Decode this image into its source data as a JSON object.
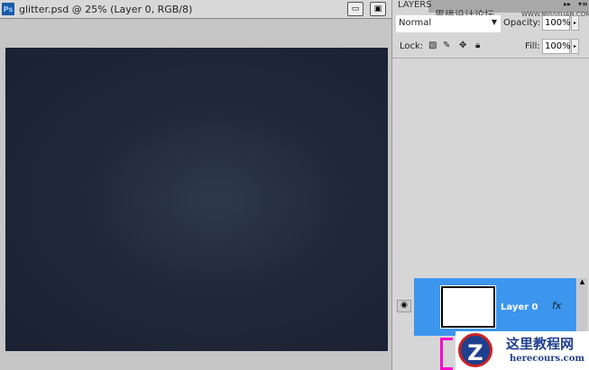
{
  "document": {
    "title": "glitter.psd @ 25% (Layer 0, RGB/8)",
    "app_icon": "Ps",
    "minimize_icon": "minimize-icon",
    "restore_icon": "restore-icon"
  },
  "layers_panel": {
    "tab": "LAYERS",
    "blend_mode": "Normal",
    "opacity_label": "Opacity:",
    "opacity": "100%",
    "lock_label": "Lock:",
    "fill_label": "Fill:",
    "fill": "100%",
    "layers": [
      {
        "name": "Layer 0",
        "fx": "fx",
        "visible": true,
        "selected": true
      }
    ]
  },
  "watermark": {
    "top_cn": "思缘设计论坛",
    "top_url": "WWW.MISSYUAN.COM",
    "logo_letter": "Z",
    "logo_cn": "这里教程网",
    "logo_url": "herecours.com"
  },
  "colors": {
    "selection": "#3d96ee",
    "canvas": "#1f2839"
  }
}
